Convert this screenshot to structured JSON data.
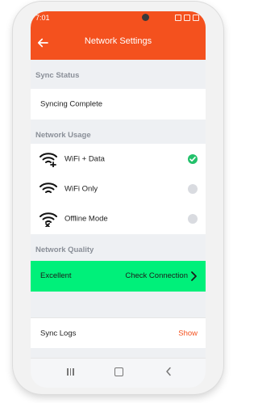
{
  "statusbar": {
    "time": "7:01"
  },
  "appbar": {
    "title": "Network Settings"
  },
  "sections": {
    "sync_status": "Sync Status",
    "network_usage": "Network Usage",
    "network_quality": "Network Quality"
  },
  "sync_status_row": {
    "label": "Syncing Complete"
  },
  "network_usage_options": [
    {
      "label": "WiFi + Data",
      "icon": "wifi-plus-icon",
      "selected": true
    },
    {
      "label": "WiFi Only",
      "icon": "wifi-icon",
      "selected": false
    },
    {
      "label": "Offline Mode",
      "icon": "wifi-off-icon",
      "selected": false
    }
  ],
  "network_quality_row": {
    "status": "Excellent",
    "action": "Check Connection",
    "color": "#00f07a"
  },
  "sync_logs_row": {
    "label": "Sync Logs",
    "action": "Show"
  },
  "colors": {
    "accent": "#f4511e",
    "selected": "#23c16b",
    "unselected": "#d9dbe0"
  },
  "navbar": {
    "recents_icon": "recents-icon",
    "home_icon": "home-icon",
    "back_icon": "back-nav-icon"
  }
}
